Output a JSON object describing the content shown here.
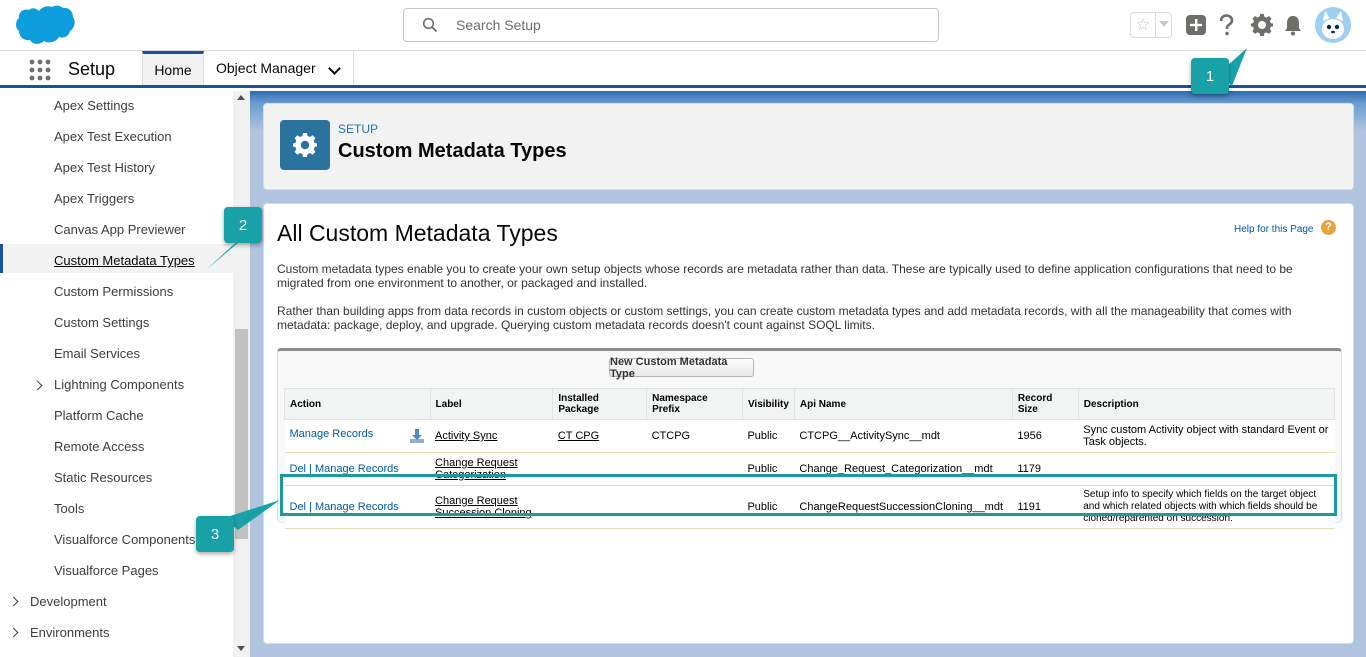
{
  "header": {
    "search_placeholder": "Search Setup"
  },
  "context_bar": {
    "app_name": "Setup",
    "tabs": [
      {
        "label": "Home"
      },
      {
        "label": "Object Manager"
      }
    ]
  },
  "sidebar": {
    "items": [
      {
        "label": "Apex Settings"
      },
      {
        "label": "Apex Test Execution"
      },
      {
        "label": "Apex Test History"
      },
      {
        "label": "Apex Triggers"
      },
      {
        "label": "Canvas App Previewer"
      },
      {
        "label": "Custom Metadata Types"
      },
      {
        "label": "Custom Permissions"
      },
      {
        "label": "Custom Settings"
      },
      {
        "label": "Email Services"
      },
      {
        "label": "Lightning Components"
      },
      {
        "label": "Platform Cache"
      },
      {
        "label": "Remote Access"
      },
      {
        "label": "Static Resources"
      },
      {
        "label": "Tools"
      },
      {
        "label": "Visualforce Components"
      },
      {
        "label": "Visualforce Pages"
      },
      {
        "label": "Development"
      },
      {
        "label": "Environments"
      }
    ]
  },
  "page_header": {
    "eyebrow": "SETUP",
    "title": "Custom Metadata Types"
  },
  "content": {
    "title": "All Custom Metadata Types",
    "help_link": "Help for this Page",
    "desc1": "Custom metadata types enable you to create your own setup objects whose records are metadata rather than data. These are typically used to define application configurations that need to be migrated from one environment to another, or packaged and installed.",
    "desc2": "Rather than building apps from data records in custom objects or custom settings, you can create custom metadata types and add metadata records, with all the manageability that comes with metadata: package, deploy, and upgrade. Querying custom metadata records doesn't count against SOQL limits.",
    "new_button": "New Custom Metadata Type",
    "table": {
      "columns": [
        "Action",
        "Label",
        "Installed Package",
        "Namespace Prefix",
        "Visibility",
        "Api Name",
        "Record Size",
        "Description"
      ],
      "rows": [
        {
          "action_del": "",
          "action_sep": "",
          "action_manage": "Manage Records",
          "label": "Activity Sync",
          "package": "CT CPG",
          "namespace": "CTCPG",
          "visibility": "Public",
          "api_name": "CTCPG__ActivitySync__mdt",
          "record_size": "1956",
          "description": "Sync custom Activity object with standard Event or Task objects."
        },
        {
          "action_del": "Del",
          "action_sep": " | ",
          "action_manage": "Manage Records",
          "label": "Change Request Categorization",
          "package": "",
          "namespace": "",
          "visibility": "Public",
          "api_name": "Change_Request_Categorization__mdt",
          "record_size": "1179",
          "description": ""
        },
        {
          "action_del": "Del",
          "action_sep": " | ",
          "action_manage": "Manage Records",
          "label": "Change Request Succession Cloning",
          "package": "",
          "namespace": "",
          "visibility": "Public",
          "api_name": "ChangeRequestSuccessionCloning__mdt",
          "record_size": "1191",
          "description": "Setup info to specify which fields on the target object and which related objects with which fields should be cloned/reparented on succession."
        }
      ]
    }
  },
  "callouts": [
    "1",
    "2",
    "3"
  ],
  "colors": {
    "brand_blue": "#1b5297",
    "callout_teal": "#19a1a8",
    "link_blue": "#015ba7"
  }
}
